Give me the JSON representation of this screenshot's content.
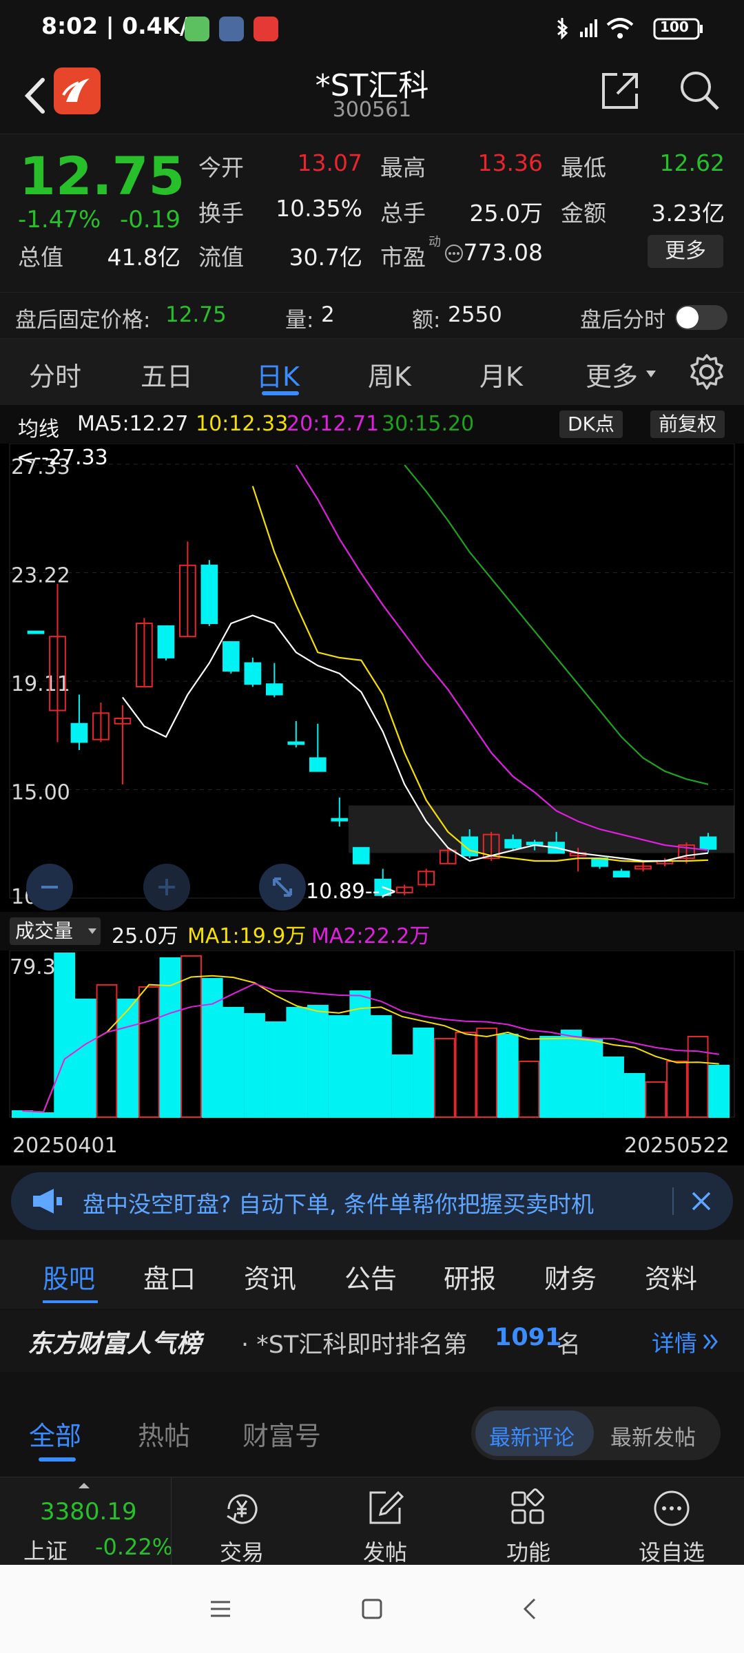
{
  "status_bar": {
    "time": "8:02 | 0.4K/s",
    "battery": "100"
  },
  "header": {
    "title": "*ST汇科",
    "code": "300561"
  },
  "quote": {
    "price": "12.75",
    "change_pct": "-1.47%",
    "change": "-0.19",
    "open_label": "今开",
    "open": "13.07",
    "high_label": "最高",
    "high": "13.36",
    "low_label": "最低",
    "low": "12.62",
    "turnover_label": "换手",
    "turnover": "10.35%",
    "volume_label": "总手",
    "volume": "25.0万",
    "amount_label": "金额",
    "amount": "3.23亿",
    "mktcap_label": "总值",
    "mktcap": "41.8亿",
    "float_label": "流值",
    "float": "30.7亿",
    "pe_label": "市盈",
    "pe_sup": "动",
    "pe": "773.08",
    "more_button": "更多"
  },
  "after_hours": {
    "price_label": "盘后固定价格: ",
    "price": "12.75",
    "vol_label": "量: ",
    "vol": "2",
    "amt_label": "额: ",
    "amt": "2550",
    "timeshare_label": "盘后分时"
  },
  "period_tabs": [
    "分时",
    "五日",
    "日K",
    "周K",
    "月K",
    "更多"
  ],
  "ma_row": {
    "label": "均线",
    "ma5": "MA5:12.27",
    "ma10": "10:12.33",
    "ma20": "20:12.71",
    "ma30": "30:15.20",
    "dk_button": "DK点",
    "adjust_button": "前复权"
  },
  "kchart": {
    "y_ticks": [
      "27.33",
      "23.22",
      "19.11",
      "15.00",
      "10.89"
    ],
    "max_marker": "<--27.33",
    "min_marker": "10.89-->"
  },
  "volume_row": {
    "label": "成交量",
    "vol": "25.0万",
    "ma1": "MA1:19.9万",
    "ma2": "MA2:22.2万",
    "y_tick": "79.3万"
  },
  "date_range": {
    "start": "20250401",
    "end": "20250522"
  },
  "banner": {
    "text": "盘中没空盯盘? 自动下单, 条件单帮你把握买卖时机"
  },
  "section_tabs": [
    "股吧",
    "盘口",
    "资讯",
    "公告",
    "研报",
    "财务",
    "资料"
  ],
  "rank": {
    "brand": "东方财富人气榜",
    "prefix": "· *ST汇科即时排名第",
    "number": "1091",
    "suffix": "名",
    "detail": "详情"
  },
  "feed_tabs": [
    "全部",
    "热帖",
    "财富号"
  ],
  "sort_toggle": [
    "最新评论",
    "最新发帖"
  ],
  "bottom_nav": {
    "index_value": "3380.19",
    "index_name": "上证",
    "index_change": "-0.22%",
    "items": [
      "交易",
      "发帖",
      "功能",
      "设自选"
    ]
  },
  "colors": {
    "up": "#e8262d",
    "down": "#00f2f2",
    "accent": "#3b8cff",
    "ma5": "#ffffff",
    "ma10": "#f5e000",
    "ma20": "#e020e0",
    "ma30": "#1fa31f"
  },
  "chart_data": {
    "type": "candlestick",
    "period": "daily",
    "ylim": [
      10.89,
      27.33
    ],
    "candles": [
      {
        "o": 21.0,
        "c": 21.0,
        "h": 21.0,
        "l": 21.0
      },
      {
        "o": 18.0,
        "c": 20.8,
        "h": 22.8,
        "l": 16.8
      },
      {
        "o": 17.5,
        "c": 16.8,
        "h": 18.6,
        "l": 16.5
      },
      {
        "o": 16.9,
        "c": 17.9,
        "h": 18.3,
        "l": 16.8
      },
      {
        "o": 17.5,
        "c": 17.7,
        "h": 18.2,
        "l": 15.2
      },
      {
        "o": 18.9,
        "c": 21.3,
        "h": 21.5,
        "l": 18.9
      },
      {
        "o": 21.2,
        "c": 20.0,
        "h": 21.2,
        "l": 19.9
      },
      {
        "o": 20.8,
        "c": 23.5,
        "h": 24.4,
        "l": 20.8
      },
      {
        "o": 23.5,
        "c": 21.3,
        "h": 23.7,
        "l": 21.2
      },
      {
        "o": 20.6,
        "c": 19.5,
        "h": 20.6,
        "l": 19.4
      },
      {
        "o": 19.8,
        "c": 19.0,
        "h": 20.0,
        "l": 18.9
      },
      {
        "o": 19.0,
        "c": 18.6,
        "h": 19.8,
        "l": 18.5
      },
      {
        "o": 16.8,
        "c": 16.8,
        "h": 17.6,
        "l": 16.6
      },
      {
        "o": 16.2,
        "c": 15.7,
        "h": 17.5,
        "l": 15.7
      },
      {
        "o": 13.9,
        "c": 13.9,
        "h": 14.7,
        "l": 13.6
      },
      {
        "o": 12.8,
        "c": 12.2,
        "h": 12.8,
        "l": 12.2
      },
      {
        "o": 11.6,
        "c": 11.0,
        "h": 12.0,
        "l": 10.9
      },
      {
        "o": 11.1,
        "c": 11.3,
        "h": 11.4,
        "l": 11.0
      },
      {
        "o": 11.4,
        "c": 11.9,
        "h": 12.0,
        "l": 11.3
      },
      {
        "o": 12.2,
        "c": 12.7,
        "h": 12.8,
        "l": 12.2
      },
      {
        "o": 13.2,
        "c": 12.5,
        "h": 13.5,
        "l": 12.4
      },
      {
        "o": 12.4,
        "c": 13.3,
        "h": 13.4,
        "l": 12.3
      },
      {
        "o": 13.1,
        "c": 12.8,
        "h": 13.3,
        "l": 12.7
      },
      {
        "o": 13.0,
        "c": 13.0,
        "h": 13.1,
        "l": 12.7
      },
      {
        "o": 13.0,
        "c": 12.6,
        "h": 13.4,
        "l": 12.6
      },
      {
        "o": 12.5,
        "c": 12.6,
        "h": 12.8,
        "l": 11.9
      },
      {
        "o": 12.4,
        "c": 12.1,
        "h": 12.4,
        "l": 12.0
      },
      {
        "o": 11.9,
        "c": 11.7,
        "h": 12.0,
        "l": 11.7
      },
      {
        "o": 12.0,
        "c": 12.1,
        "h": 12.3,
        "l": 11.9
      },
      {
        "o": 12.2,
        "c": 12.3,
        "h": 12.4,
        "l": 12.1
      },
      {
        "o": 12.4,
        "c": 12.9,
        "h": 13.0,
        "l": 12.2
      },
      {
        "o": 13.2,
        "c": 12.75,
        "h": 13.36,
        "l": 12.62
      }
    ],
    "ma5": [
      null,
      null,
      null,
      null,
      18.5,
      17.4,
      17.0,
      18.6,
      19.8,
      21.3,
      21.6,
      21.3,
      20.2,
      19.7,
      19.4,
      18.7,
      17.2,
      15.2,
      13.8,
      12.8,
      12.3,
      12.5,
      12.7,
      12.9,
      12.8,
      12.6,
      12.5,
      12.4,
      12.3,
      12.3,
      12.5,
      12.6
    ],
    "ma10": [
      null,
      null,
      null,
      null,
      null,
      null,
      null,
      null,
      null,
      26.5,
      24.0,
      22.0,
      20.2,
      20.0,
      19.9,
      18.6,
      16.4,
      14.6,
      13.4,
      12.7,
      12.5,
      12.4,
      12.3,
      12.3,
      12.4,
      12.4,
      12.3,
      12.27,
      12.3,
      12.3,
      12.33
    ],
    "ma20": [
      27.3,
      26.0,
      24.5,
      23.2,
      22.0,
      20.9,
      19.8,
      18.8,
      17.6,
      16.4,
      15.5,
      14.9,
      14.2,
      13.8,
      13.5,
      13.3,
      13.1,
      12.9,
      12.8,
      12.71
    ],
    "ma30": [
      27.3,
      26.3,
      25.2,
      24.0,
      23.0,
      22.0,
      21.0,
      20.0,
      19.0,
      18.0,
      17.0,
      16.2,
      15.7,
      15.4,
      15.2
    ],
    "volume": [
      3,
      2,
      79.3,
      57,
      64,
      57,
      63,
      77,
      78,
      67,
      53,
      50,
      46,
      53,
      54,
      49,
      61,
      49,
      30,
      43,
      38,
      41,
      43,
      40,
      27,
      39,
      42,
      38,
      29,
      21,
      17,
      27,
      39,
      25.0
    ],
    "ylim_volume": [
      0,
      79.3
    ]
  }
}
